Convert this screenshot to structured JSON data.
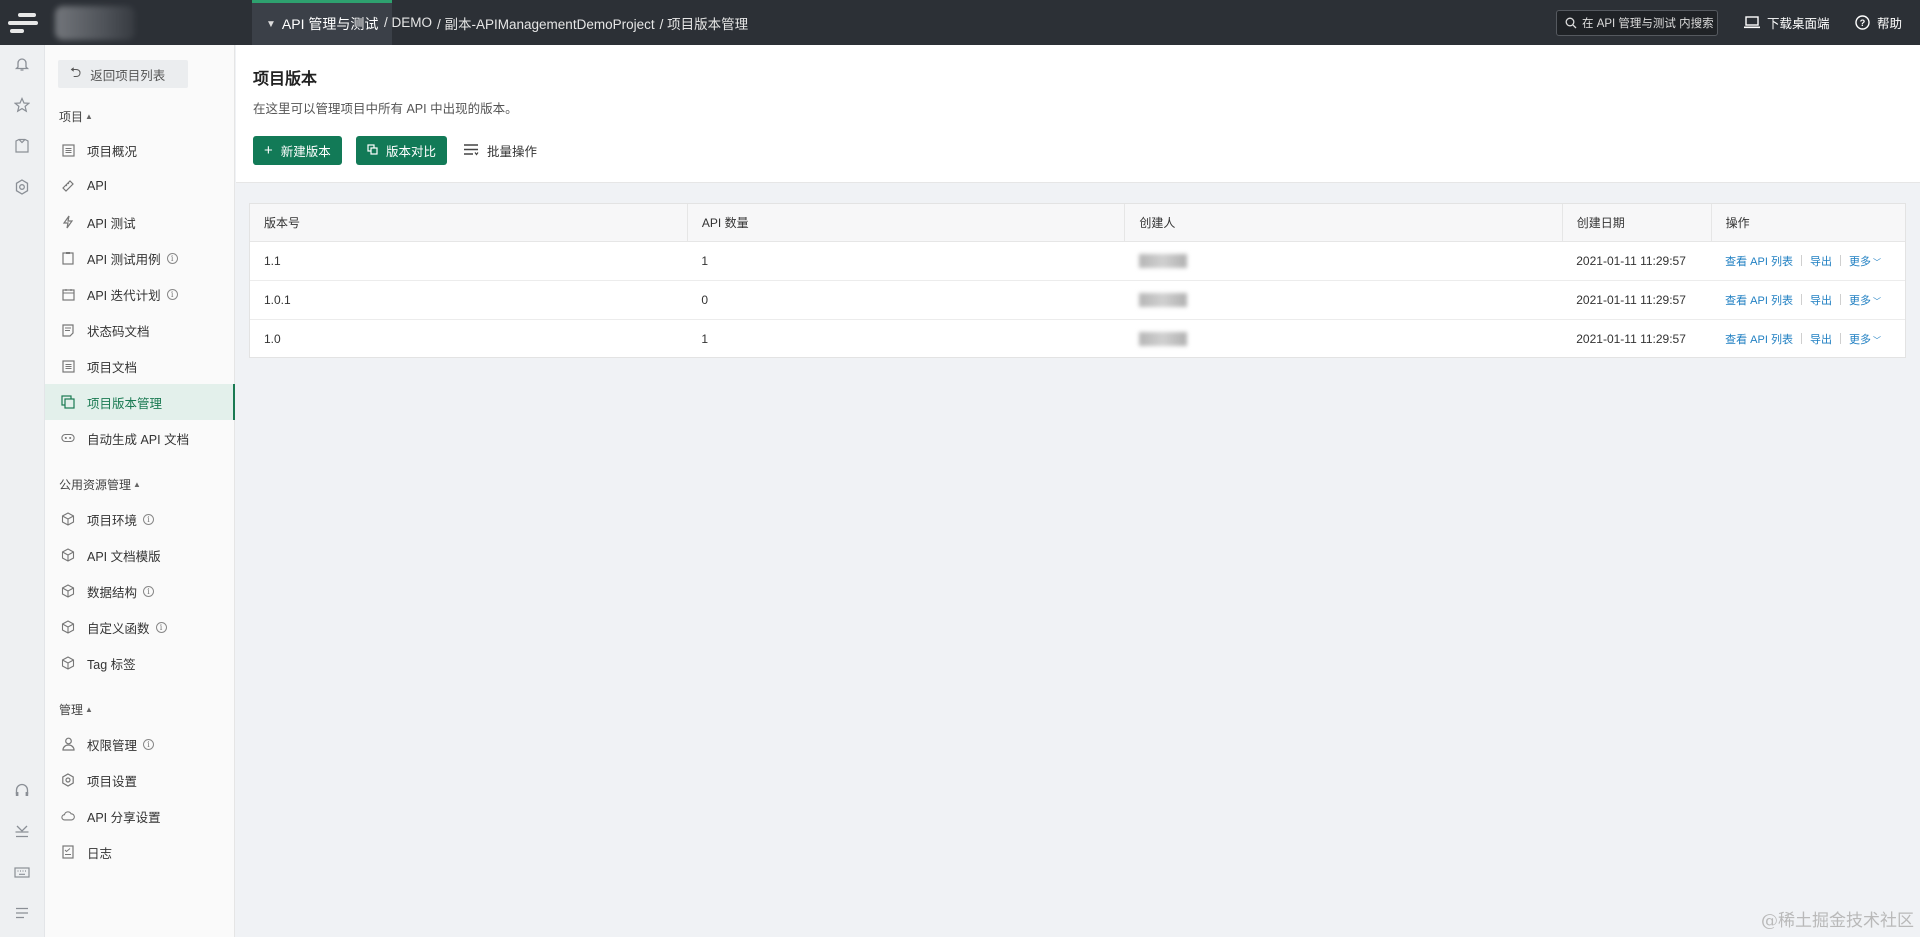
{
  "topbar": {
    "module": "API 管理与测试",
    "breadcrumb": [
      "/ DEMO",
      "/ 副本-APIManagementDemoProject",
      "/ 项目版本管理"
    ],
    "search_placeholder": "在 API 管理与测试 内搜索",
    "download_label": "下载桌面端",
    "help_label": "帮助"
  },
  "rail": {
    "top_icons": [
      "bell-icon",
      "star-icon",
      "shirt-icon",
      "gear-icon"
    ],
    "bottom_icons": [
      "headset-icon",
      "download-tray-icon",
      "keyboard-icon",
      "menu-icon"
    ]
  },
  "sidebar": {
    "back_label": "返回项目列表",
    "sections": [
      {
        "title": "项目",
        "items": [
          {
            "label": "项目概况",
            "icon": "overview-icon",
            "info": false
          },
          {
            "label": "API",
            "icon": "api-icon",
            "info": false
          },
          {
            "label": "API 测试",
            "icon": "bolt-icon",
            "info": false
          },
          {
            "label": "API 测试用例",
            "icon": "clipboard-icon",
            "info": true
          },
          {
            "label": "API 迭代计划",
            "icon": "calendar-icon",
            "info": true
          },
          {
            "label": "状态码文档",
            "icon": "doc-icon",
            "info": false
          },
          {
            "label": "项目文档",
            "icon": "doc-icon",
            "info": false
          },
          {
            "label": "项目版本管理",
            "icon": "versions-icon",
            "info": false,
            "active": true
          },
          {
            "label": "自动生成 API 文档",
            "icon": "robot-icon",
            "info": false
          }
        ]
      },
      {
        "title": "公用资源管理",
        "items": [
          {
            "label": "项目环境",
            "icon": "cube-icon",
            "info": true
          },
          {
            "label": "API 文档模版",
            "icon": "cube-icon",
            "info": false
          },
          {
            "label": "数据结构",
            "icon": "cube-icon",
            "info": true
          },
          {
            "label": "自定义函数",
            "icon": "cube-icon",
            "info": true
          },
          {
            "label": "Tag 标签",
            "icon": "cube-icon",
            "info": false
          }
        ]
      },
      {
        "title": "管理",
        "items": [
          {
            "label": "权限管理",
            "icon": "user-icon",
            "info": true
          },
          {
            "label": "项目设置",
            "icon": "gear-icon",
            "info": false
          },
          {
            "label": "API 分享设置",
            "icon": "cloud-icon",
            "info": false
          },
          {
            "label": "日志",
            "icon": "log-icon",
            "info": false
          }
        ]
      }
    ]
  },
  "main": {
    "title": "项目版本",
    "description": "在这里可以管理项目中所有 API 中出现的版本。",
    "buttons": {
      "new_version": "新建版本",
      "compare": "版本对比",
      "batch": "批量操作"
    },
    "table": {
      "columns": [
        "版本号",
        "API 数量",
        "创建人",
        "创建日期",
        "操作"
      ],
      "rows": [
        {
          "version": "1.1",
          "api_count": "1",
          "created": "2021-01-11 11:29:57"
        },
        {
          "version": "1.0.1",
          "api_count": "0",
          "created": "2021-01-11 11:29:57"
        },
        {
          "version": "1.0",
          "api_count": "1",
          "created": "2021-01-11 11:29:57"
        }
      ],
      "ops": {
        "view": "查看 API 列表",
        "export": "导出",
        "more": "更多"
      }
    }
  },
  "watermark": "@稀土掘金技术社区",
  "colors": {
    "accent": "#127a57",
    "topbar": "#2c3036",
    "link": "#1f7fc2"
  }
}
